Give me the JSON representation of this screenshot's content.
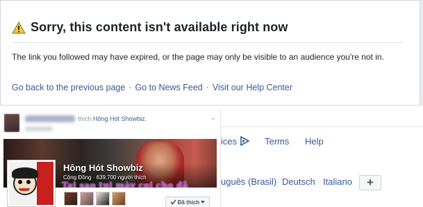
{
  "error": {
    "title": "Sorry, this content isn't available right now",
    "message": "The link you followed may have expired, or the page may only be visible to an audience you're not in.",
    "links": [
      {
        "label": "Go back to the previous page"
      },
      {
        "label": "Go to News Feed"
      },
      {
        "label": "Visit our Help Center"
      }
    ],
    "separator": "·"
  },
  "footer": {
    "row1": {
      "ad_choices_partial": "ices",
      "terms": "Terms",
      "help": "Help"
    },
    "row2": {
      "portuguese_partial": "uguês (Brasil)",
      "deutsch": "Deutsch",
      "italiano": "Italiano"
    },
    "add_language_button": "+"
  },
  "post": {
    "verb": "thích",
    "page_link": "Hông Hót Showbiz.",
    "chevron": "⌄",
    "page": {
      "name": "Hông Hót Showbiz",
      "subtitle": "Cộng Đồng · 639.700 người thích",
      "cover_caption": "Tai sao tui mày coi cho đã",
      "like_button": "Đã thích"
    }
  },
  "icons": {
    "warning": "warning-triangle-icon",
    "ad_choices": "ad-choices-icon",
    "check": "check-icon",
    "caret": "caret-down-icon"
  },
  "colors": {
    "link": "#365899",
    "warning_fill": "#f5c33b",
    "page_background": "#e9ebee"
  }
}
